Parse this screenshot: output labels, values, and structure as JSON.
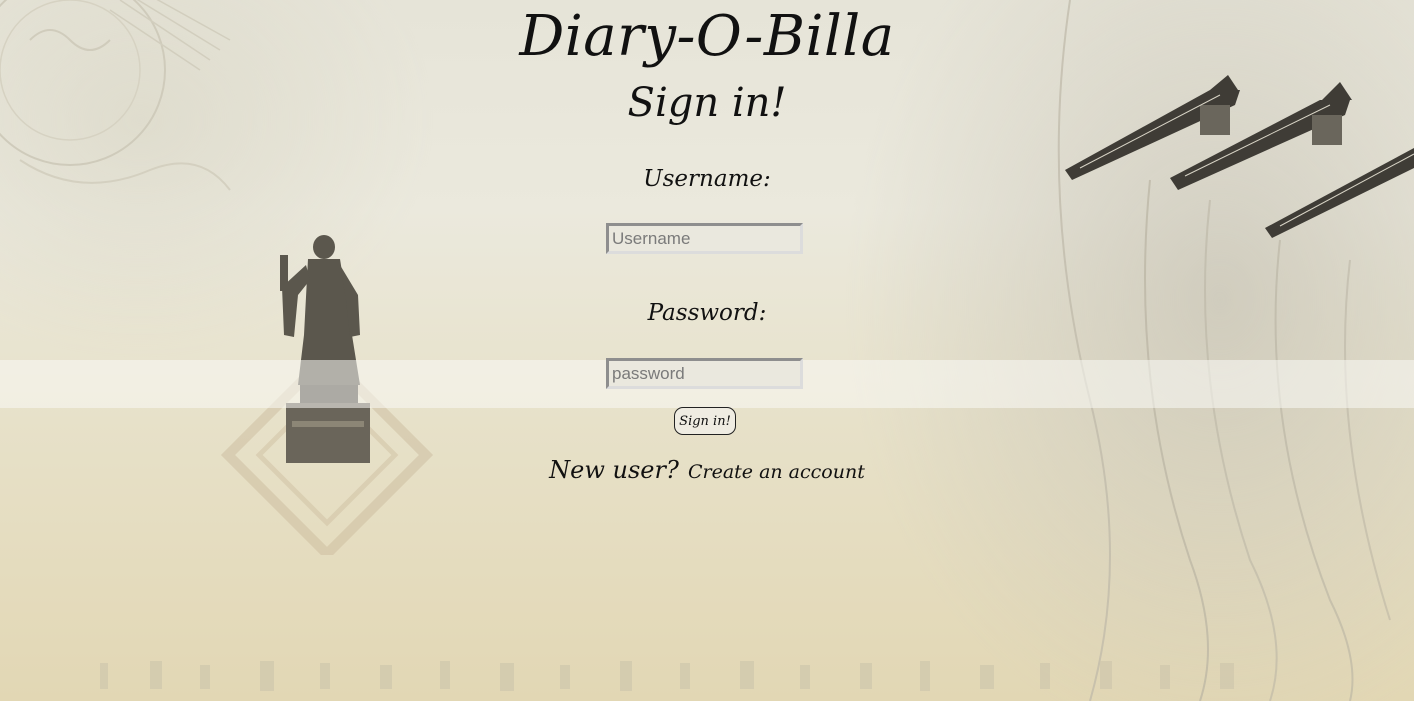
{
  "header": {
    "site_title": "Diary-O-Billa",
    "heading": "Sign in!"
  },
  "form": {
    "username_label": "Username:",
    "username_placeholder": "Username",
    "username_value": "",
    "password_label": "Password:",
    "password_placeholder": "password",
    "password_value": "",
    "submit_label": "Sign in!"
  },
  "footer": {
    "new_user_text": "New user?",
    "create_account_link": "Create an account"
  },
  "background": {
    "icons": [
      "statue-icon",
      "temple-roof-icon",
      "seal-stamp-icon"
    ]
  }
}
